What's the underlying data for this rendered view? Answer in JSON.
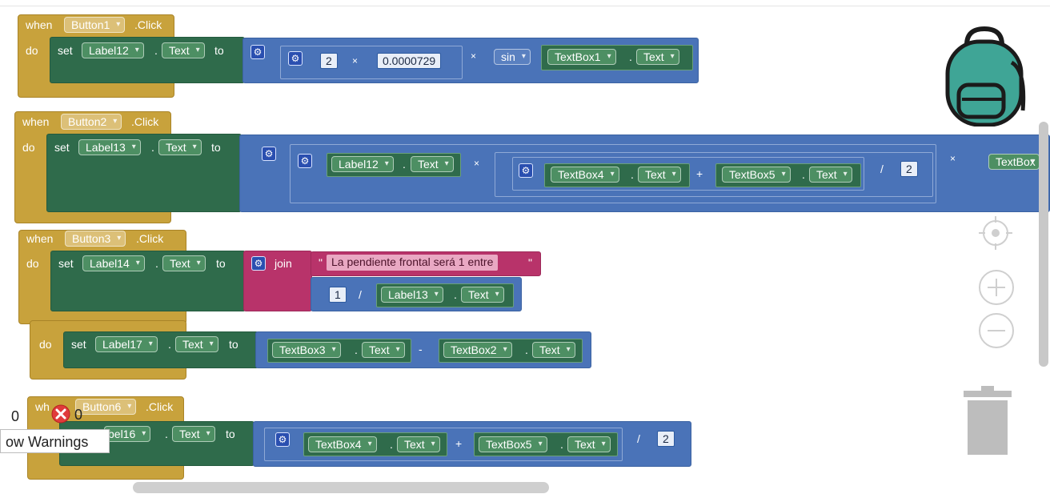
{
  "events": [
    {
      "when": "when",
      "component": "Button1",
      "event": ".Click",
      "do": "do",
      "set": "set",
      "target": "Label12",
      "dot": ".",
      "prop": "Text",
      "to": "to",
      "expr": {
        "num_a": "2",
        "op1": "×",
        "num_b": "0.0000729",
        "op2": "×",
        "func": "sin",
        "comp": "TextBox1",
        "dot": ".",
        "prop": "Text"
      }
    },
    {
      "when": "when",
      "component": "Button2",
      "event": ".Click",
      "do": "do",
      "set": "set",
      "target": "Label13",
      "dot": ".",
      "prop": "Text",
      "to": "to",
      "expr": {
        "a_comp": "Label12",
        "dot": ".",
        "a_prop": "Text",
        "op1": "×",
        "b_comp": "TextBox4",
        "b_prop": "Text",
        "plus": "+",
        "c_comp": "TextBox5",
        "c_prop": "Text",
        "div": "/",
        "num": "2",
        "op2": "×",
        "d_comp": "TextBox"
      }
    },
    {
      "when": "when",
      "component": "Button3",
      "event": ".Click",
      "do": "do",
      "set": "set",
      "target": "Label14",
      "dot": ".",
      "prop": "Text",
      "to": "to",
      "expr": {
        "join": "join",
        "quote": "\"",
        "string": "La pendiente frontal será 1 entre",
        "num": "1",
        "div": "/",
        "comp": "Label13",
        "dot": ".",
        "prop": "Text"
      }
    },
    {
      "do": "do",
      "set": "set",
      "target": "Label17",
      "dot": ".",
      "prop": "Text",
      "to": "to",
      "expr": {
        "a_comp": "TextBox3",
        "a_prop": "Text",
        "minus": "-",
        "b_comp": "TextBox2",
        "b_prop": "Text"
      }
    },
    {
      "when": "wh",
      "component": "Button6",
      "event": ".Click",
      "target": "bel16",
      "dot": ".",
      "prop": "Text",
      "to": "to",
      "expr": {
        "a_comp": "TextBox4",
        "a_prop": "Text",
        "plus": "+",
        "b_comp": "TextBox5",
        "b_prop": "Text",
        "div": "/",
        "num": "2"
      }
    }
  ],
  "warnings": {
    "warn_count": "0",
    "error_count": "0",
    "toggle_label": "ow Warnings"
  },
  "colors": {
    "event": "#c8a23c",
    "setter": "#2f6b4b",
    "math": "#4a73b8",
    "text": "#b8336a",
    "backpack": "#3fa596"
  },
  "icons": [
    "backpack-icon",
    "gear-icon",
    "target-icon",
    "zoom-in-icon",
    "zoom-out-icon",
    "trash-icon",
    "error-icon"
  ]
}
